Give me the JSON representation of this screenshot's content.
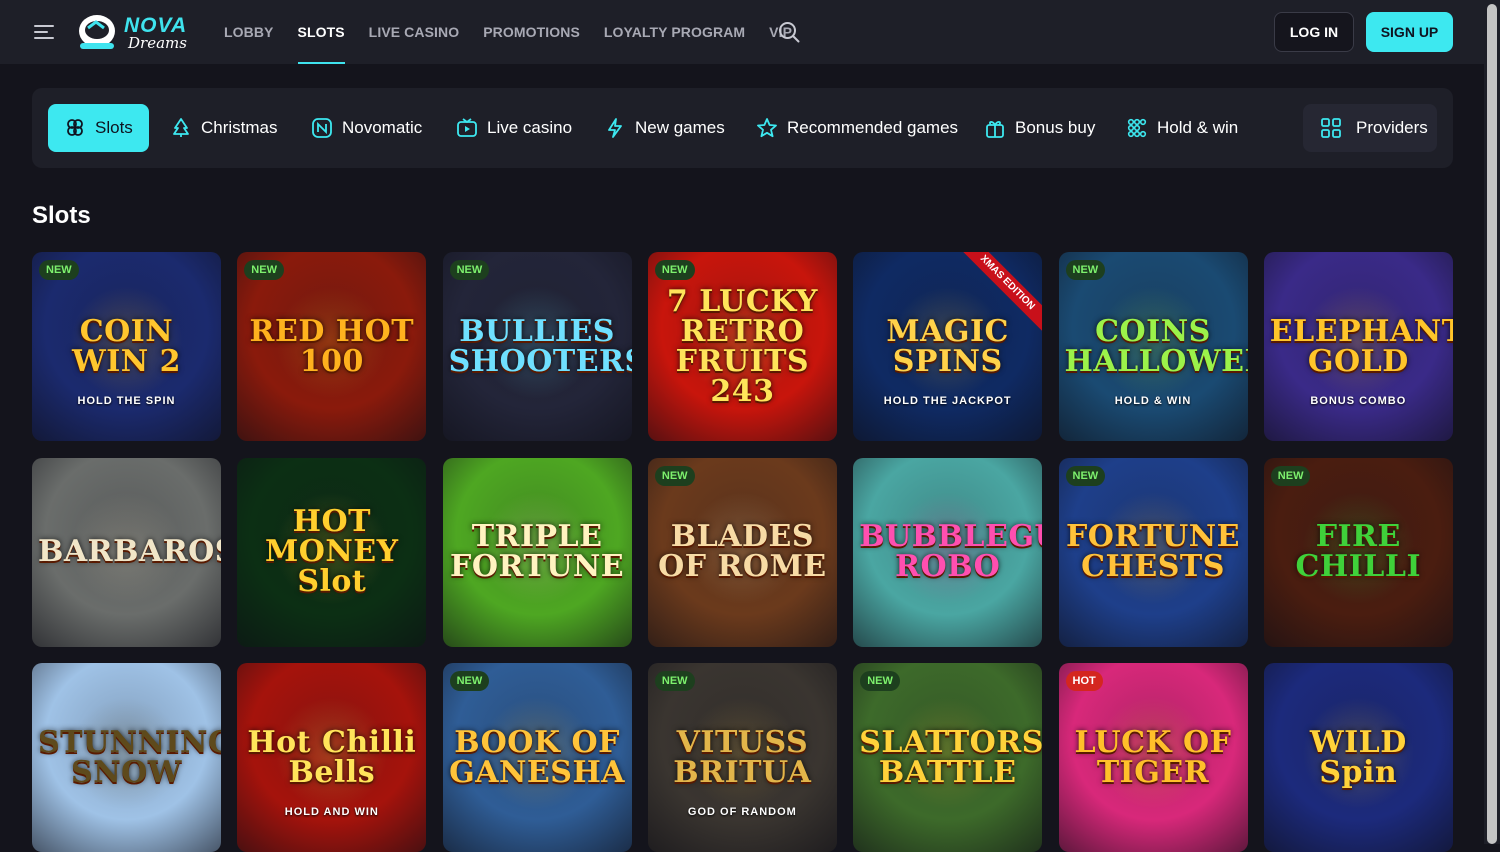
{
  "header": {
    "logo_top": "NOVA",
    "logo_bottom": "Dreams",
    "nav": [
      "LOBBY",
      "SLOTS",
      "LIVE CASINO",
      "PROMOTIONS",
      "LOYALTY PROGRAM",
      "VIP"
    ],
    "active_nav": "SLOTS",
    "login_label": "LOG IN",
    "signup_label": "SIGN UP"
  },
  "categories": [
    {
      "label": "Slots",
      "icon": "clover-icon"
    },
    {
      "label": "Christmas",
      "icon": "christmas-tree-icon"
    },
    {
      "label": "Novomatic",
      "icon": "novomatic-icon"
    },
    {
      "label": "Live casino",
      "icon": "tv-icon"
    },
    {
      "label": "New games",
      "icon": "lightning-icon"
    },
    {
      "label": "Recommended games",
      "icon": "star-icon"
    },
    {
      "label": "Bonus buy",
      "icon": "gift-icon"
    },
    {
      "label": "Hold & win",
      "icon": "dots-icon"
    }
  ],
  "providers_label": "Providers",
  "section_title": "Slots",
  "games": [
    {
      "title": "COIN WIN 2",
      "sub": "HOLD THE SPIN",
      "badge": "NEW",
      "bg": "#1b2a6e",
      "fg": "#ffc62e"
    },
    {
      "title": "RED HOT 100",
      "sub": "",
      "badge": "NEW",
      "bg": "#8a1a0c",
      "fg": "#ffb21e"
    },
    {
      "title": "BULLIES SHOOTERS",
      "sub": "",
      "badge": "NEW",
      "bg": "#232539",
      "fg": "#6fe0ff"
    },
    {
      "title": "7 LUCKY RETRO FRUITS 243",
      "sub": "",
      "badge": "NEW",
      "bg": "#c8150c",
      "fg": "#ffe45a"
    },
    {
      "title": "MAGIC SPINS",
      "sub": "HOLD THE JACKPOT",
      "badge": "XMAS EDITION",
      "bg": "#0f2a63",
      "fg": "#ffd24a"
    },
    {
      "title": "COINS HALLOWEEN",
      "sub": "HOLD & WIN",
      "badge": "NEW",
      "bg": "#1a4a72",
      "fg": "#9bf24a"
    },
    {
      "title": "ELEPHANT'S GOLD",
      "sub": "BONUS COMBO",
      "badge": "",
      "bg": "#3a2a88",
      "fg": "#ffc52a"
    },
    {
      "title": "BARBAROSSA",
      "sub": "",
      "badge": "",
      "bg": "#6a6d6b",
      "fg": "#f1e6c8"
    },
    {
      "title": "HOT MONEY Slot",
      "sub": "",
      "badge": "",
      "bg": "#0c2f14",
      "fg": "#ffcf2e"
    },
    {
      "title": "TRIPLE FORTUNE",
      "sub": "",
      "badge": "",
      "bg": "#4ea722",
      "fg": "#fff3c0"
    },
    {
      "title": "BLADES OF ROME",
      "sub": "",
      "badge": "NEW",
      "bg": "#6b3a1c",
      "fg": "#f7dba5"
    },
    {
      "title": "BUBBLEGUM ROBO",
      "sub": "",
      "badge": "",
      "bg": "#4aa6a2",
      "fg": "#ff4fb0"
    },
    {
      "title": "FORTUNE CHESTS",
      "sub": "",
      "badge": "NEW",
      "bg": "#1e3f8a",
      "fg": "#ffc23a"
    },
    {
      "title": "FIRE CHILLI",
      "sub": "",
      "badge": "NEW",
      "bg": "#4a1d10",
      "fg": "#3fd13a"
    },
    {
      "title": "STUNNING SNOW",
      "sub": "",
      "badge": "",
      "bg": "#9fc2e6",
      "fg": "#5e4a1c"
    },
    {
      "title": "Hot Chilli Bells",
      "sub": "HOLD AND WIN",
      "badge": "",
      "bg": "#a5130c",
      "fg": "#ffe45a"
    },
    {
      "title": "BOOK OF GANESHA",
      "sub": "",
      "badge": "NEW",
      "bg": "#2f5d96",
      "fg": "#ffc43a"
    },
    {
      "title": "VITUSS BRITUA",
      "sub": "GOD OF RANDOM",
      "badge": "NEW",
      "bg": "#3a3530",
      "fg": "#e2b54a"
    },
    {
      "title": "SLATTORS BATTLE",
      "sub": "",
      "badge": "NEW",
      "bg": "#3d6a2a",
      "fg": "#ffd23a"
    },
    {
      "title": "LUCK OF TIGER",
      "sub": "",
      "badge": "HOT",
      "bg": "#d8287a",
      "fg": "#ffc02a"
    },
    {
      "title": "WILD Spin",
      "sub": "",
      "badge": "",
      "bg": "#1c2a7c",
      "fg": "#ffd23a"
    }
  ],
  "colors": {
    "accent": "#3de8f0",
    "panel": "#1e1f28",
    "page_bg": "#14141c"
  }
}
